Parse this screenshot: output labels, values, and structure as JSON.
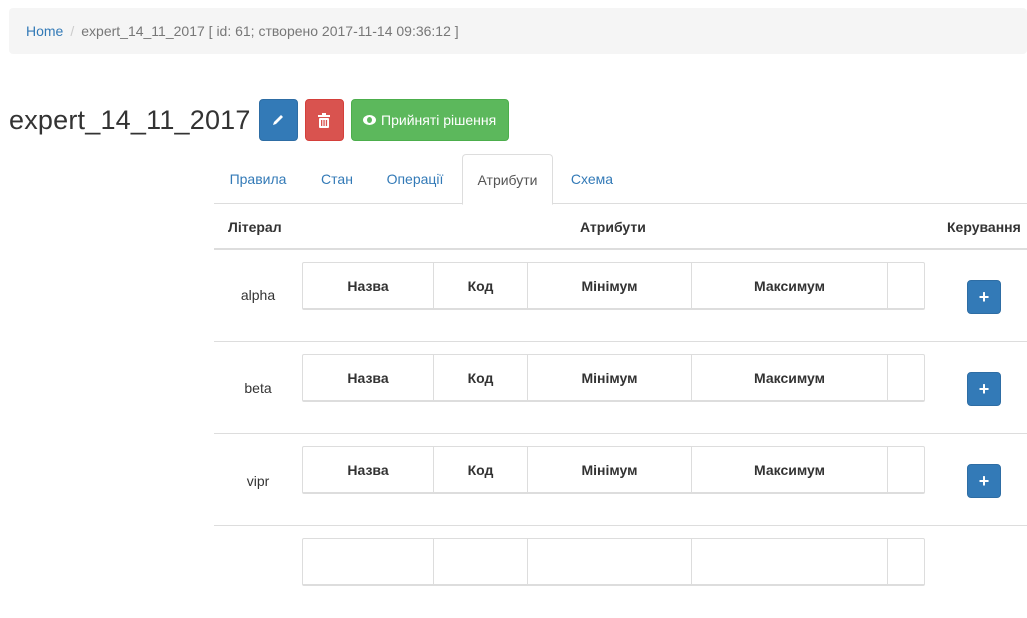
{
  "breadcrumb": {
    "home": "Home",
    "separator": "/",
    "current": "expert_14_11_2017 [ id: 61; створено 2017-11-14 09:36:12 ]"
  },
  "title": "expert_14_11_2017",
  "actions": {
    "edit_icon": "pencil-icon",
    "delete_icon": "trash-icon",
    "decisions_label": "Прийняті рішення",
    "decisions_icon": "eye-icon"
  },
  "tabs": [
    {
      "label": "Правила",
      "active": false
    },
    {
      "label": "Стан",
      "active": false
    },
    {
      "label": "Операції",
      "active": false
    },
    {
      "label": "Атрибути",
      "active": true
    },
    {
      "label": "Схема",
      "active": false
    }
  ],
  "table": {
    "headers": {
      "literal": "Літерал",
      "attributes": "Атрибути",
      "controls": "Керування"
    },
    "inner_headers": [
      "Назва",
      "Код",
      "Мінімум",
      "Максимум",
      ""
    ],
    "rows": [
      {
        "literal": "alpha",
        "add_label": "+"
      },
      {
        "literal": "beta",
        "add_label": "+"
      },
      {
        "literal": "vipr",
        "add_label": "+"
      }
    ]
  },
  "colors": {
    "primary": "#337ab7",
    "danger": "#d9534f",
    "success": "#5cb85c"
  }
}
